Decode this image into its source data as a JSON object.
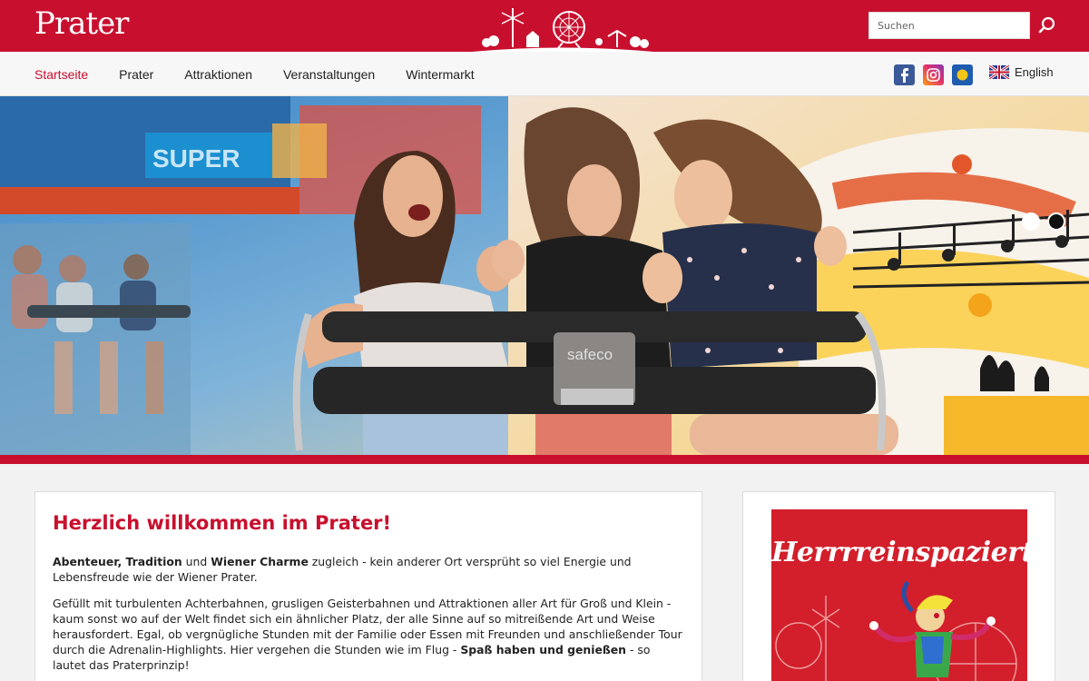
{
  "header": {
    "logo_text": "Prater",
    "search": {
      "placeholder": "Suchen"
    },
    "brand_color": "#c8102e"
  },
  "nav": {
    "items": [
      {
        "label": "Startseite",
        "active": true
      },
      {
        "label": "Prater",
        "active": false
      },
      {
        "label": "Attraktionen",
        "active": false
      },
      {
        "label": "Veranstaltungen",
        "active": false
      },
      {
        "label": "Wintermarkt",
        "active": false
      }
    ],
    "social": [
      "facebook-icon",
      "instagram-icon",
      "tiktok-icon"
    ],
    "language": "English"
  },
  "hero": {
    "ride_sign": "SUPER",
    "bar_brand": "safeco",
    "slides": 2,
    "active_slide": 2
  },
  "welcome": {
    "title": "Herzlich willkommen im Prater!",
    "p1_b1": "Abenteuer, Tradition",
    "p1_t1": " und ",
    "p1_b2": "Wiener Charme",
    "p1_t2": " zugleich - kein anderer Ort versprüht so viel Energie und Lebensfreude wie der Wiener Prater.",
    "p2_t1": "Gefüllt mit turbulenten Achterbahnen, grusligen Geisterbahnen und Attraktionen aller Art für Groß und Klein - kaum sonst wo auf der Welt findet sich ein ähnlicher Platz, der alle Sinne auf so mitreißende Art und Weise herausfordert. Egal, ob vergnügliche Stunden mit der Familie oder Essen mit Freunden und anschließender Tour durch die Adrenalin-Highlights. Hier vergehen die Stunden wie im Flug - ",
    "p2_b1": "Spaß haben und genießen",
    "p2_t2": " - so lautet das Praterprinzip!"
  },
  "promo": {
    "title": "Herrrreinspaziert!"
  }
}
